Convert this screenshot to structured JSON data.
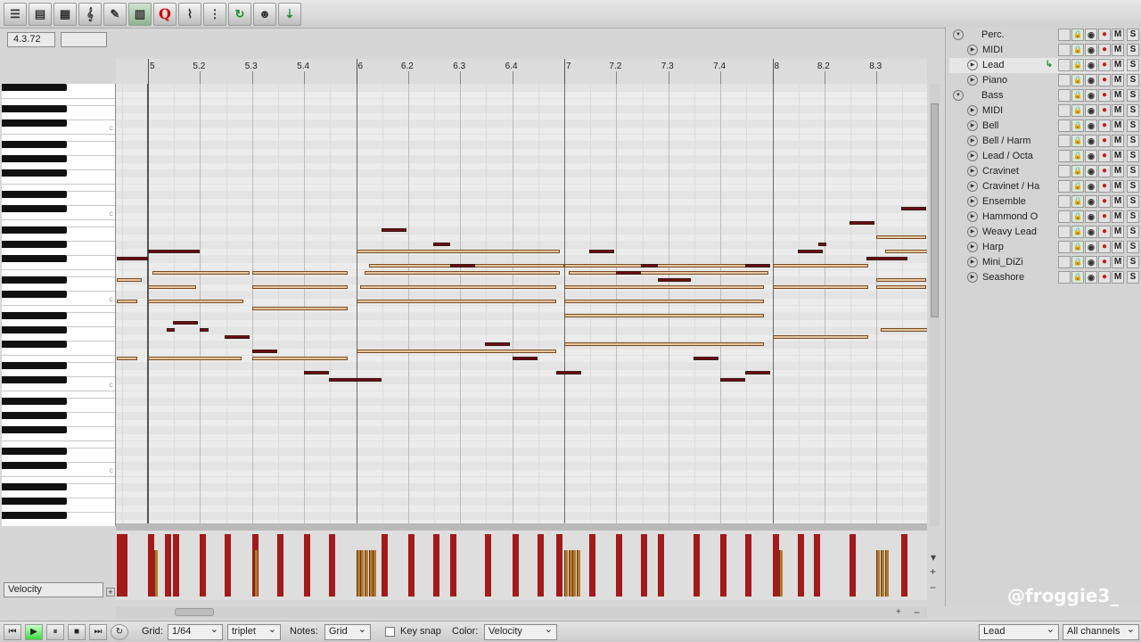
{
  "toolbar": {
    "buttons": [
      {
        "name": "menu-icon",
        "glyph": "☰"
      },
      {
        "name": "list-view-icon",
        "glyph": "▤"
      },
      {
        "name": "grid-view-icon",
        "glyph": "▦"
      },
      {
        "name": "treble-clef-icon",
        "glyph": "𝄞"
      },
      {
        "name": "note-tool-icon",
        "glyph": "✎"
      },
      {
        "name": "piano-roll-icon",
        "glyph": "▥"
      },
      {
        "name": "quantize-icon",
        "glyph": "Q"
      },
      {
        "name": "cc-edit-icon",
        "glyph": "⌇"
      },
      {
        "name": "snap-grid-icon",
        "glyph": "⋮"
      },
      {
        "name": "loop-icon",
        "glyph": "↻"
      },
      {
        "name": "humanize-icon",
        "glyph": "☻"
      },
      {
        "name": "record-input-icon",
        "glyph": "⇣"
      }
    ]
  },
  "position": {
    "value": "4.3.72",
    "length": ""
  },
  "ruler": {
    "labels": [
      {
        "text": "5",
        "bar": 5
      },
      {
        "text": "5.2",
        "bar": 5.25
      },
      {
        "text": "5.3",
        "bar": 5.5
      },
      {
        "text": "5.4",
        "bar": 5.75
      },
      {
        "text": "6",
        "bar": 6
      },
      {
        "text": "6.2",
        "bar": 6.25
      },
      {
        "text": "6.3",
        "bar": 6.5
      },
      {
        "text": "6.4",
        "bar": 6.75
      },
      {
        "text": "7",
        "bar": 7
      },
      {
        "text": "7.2",
        "bar": 7.25
      },
      {
        "text": "7.3",
        "bar": 7.5
      },
      {
        "text": "7.4",
        "bar": 7.75
      },
      {
        "text": "8",
        "bar": 8
      },
      {
        "text": "8.2",
        "bar": 8.25
      },
      {
        "text": "8.3",
        "bar": 8.5
      }
    ]
  },
  "notes": [
    {
      "bar": 4.85,
      "len": 0.15,
      "pitch": 66,
      "sel": true
    },
    {
      "bar": 4.85,
      "len": 0.12,
      "pitch": 63,
      "sel": false
    },
    {
      "bar": 4.85,
      "len": 0.1,
      "pitch": 60,
      "sel": false
    },
    {
      "bar": 4.85,
      "len": 0.1,
      "pitch": 52,
      "sel": false
    },
    {
      "bar": 5.0,
      "len": 0.25,
      "pitch": 67,
      "sel": true
    },
    {
      "bar": 5.02,
      "len": 0.47,
      "pitch": 64,
      "sel": false
    },
    {
      "bar": 5.0,
      "len": 0.23,
      "pitch": 62,
      "sel": false
    },
    {
      "bar": 5.0,
      "len": 0.46,
      "pitch": 60,
      "sel": false
    },
    {
      "bar": 5.0,
      "len": 0.45,
      "pitch": 52,
      "sel": false
    },
    {
      "bar": 5.12,
      "len": 0.12,
      "pitch": 57,
      "sel": true
    },
    {
      "bar": 5.09,
      "len": 0.04,
      "pitch": 56,
      "sel": true
    },
    {
      "bar": 5.25,
      "len": 0.04,
      "pitch": 56,
      "sel": true
    },
    {
      "bar": 5.37,
      "len": 0.12,
      "pitch": 55,
      "sel": true
    },
    {
      "bar": 5.5,
      "len": 0.46,
      "pitch": 64,
      "sel": false
    },
    {
      "bar": 5.5,
      "len": 0.46,
      "pitch": 62,
      "sel": false
    },
    {
      "bar": 5.5,
      "len": 0.46,
      "pitch": 59,
      "sel": false
    },
    {
      "bar": 5.5,
      "len": 0.46,
      "pitch": 52,
      "sel": false
    },
    {
      "bar": 5.5,
      "len": 0.12,
      "pitch": 53,
      "sel": true
    },
    {
      "bar": 5.75,
      "len": 0.12,
      "pitch": 50,
      "sel": true
    },
    {
      "bar": 5.87,
      "len": 0.25,
      "pitch": 49,
      "sel": true
    },
    {
      "bar": 6.0,
      "len": 0.98,
      "pitch": 67,
      "sel": false
    },
    {
      "bar": 6.06,
      "len": 0.94,
      "pitch": 65,
      "sel": false
    },
    {
      "bar": 6.04,
      "len": 0.94,
      "pitch": 64,
      "sel": false
    },
    {
      "bar": 6.02,
      "len": 0.94,
      "pitch": 62,
      "sel": false
    },
    {
      "bar": 6.0,
      "len": 0.96,
      "pitch": 60,
      "sel": false
    },
    {
      "bar": 6.0,
      "len": 0.96,
      "pitch": 53,
      "sel": false
    },
    {
      "bar": 6.12,
      "len": 0.12,
      "pitch": 70,
      "sel": true
    },
    {
      "bar": 6.37,
      "len": 0.08,
      "pitch": 68,
      "sel": true
    },
    {
      "bar": 6.45,
      "len": 0.12,
      "pitch": 65,
      "sel": true
    },
    {
      "bar": 6.62,
      "len": 0.12,
      "pitch": 54,
      "sel": true
    },
    {
      "bar": 6.75,
      "len": 0.12,
      "pitch": 52,
      "sel": true
    },
    {
      "bar": 6.96,
      "len": 0.12,
      "pitch": 50,
      "sel": true
    },
    {
      "bar": 7.0,
      "len": 0.96,
      "pitch": 65,
      "sel": false
    },
    {
      "bar": 7.02,
      "len": 0.96,
      "pitch": 64,
      "sel": false
    },
    {
      "bar": 7.0,
      "len": 0.96,
      "pitch": 62,
      "sel": false
    },
    {
      "bar": 7.0,
      "len": 0.96,
      "pitch": 60,
      "sel": false
    },
    {
      "bar": 7.0,
      "len": 0.96,
      "pitch": 58,
      "sel": false
    },
    {
      "bar": 7.0,
      "len": 0.96,
      "pitch": 54,
      "sel": false
    },
    {
      "bar": 7.12,
      "len": 0.12,
      "pitch": 67,
      "sel": true
    },
    {
      "bar": 7.25,
      "len": 0.12,
      "pitch": 64,
      "sel": true
    },
    {
      "bar": 7.37,
      "len": 0.08,
      "pitch": 65,
      "sel": true
    },
    {
      "bar": 7.45,
      "len": 0.16,
      "pitch": 63,
      "sel": true
    },
    {
      "bar": 7.62,
      "len": 0.12,
      "pitch": 52,
      "sel": true
    },
    {
      "bar": 7.75,
      "len": 0.12,
      "pitch": 49,
      "sel": true
    },
    {
      "bar": 7.87,
      "len": 0.12,
      "pitch": 50,
      "sel": true
    },
    {
      "bar": 7.87,
      "len": 0.12,
      "pitch": 65,
      "sel": true
    },
    {
      "bar": 8.0,
      "len": 0.46,
      "pitch": 65,
      "sel": false
    },
    {
      "bar": 8.0,
      "len": 0.46,
      "pitch": 62,
      "sel": false
    },
    {
      "bar": 8.0,
      "len": 0.46,
      "pitch": 55,
      "sel": false
    },
    {
      "bar": 8.12,
      "len": 0.12,
      "pitch": 67,
      "sel": true
    },
    {
      "bar": 8.22,
      "len": 0.04,
      "pitch": 68,
      "sel": true
    },
    {
      "bar": 8.37,
      "len": 0.12,
      "pitch": 71,
      "sel": true
    },
    {
      "bar": 8.5,
      "len": 0.24,
      "pitch": 69,
      "sel": false
    },
    {
      "bar": 8.54,
      "len": 0.24,
      "pitch": 67,
      "sel": false
    },
    {
      "bar": 8.5,
      "len": 0.24,
      "pitch": 63,
      "sel": false
    },
    {
      "bar": 8.5,
      "len": 0.24,
      "pitch": 62,
      "sel": false
    },
    {
      "bar": 8.52,
      "len": 0.24,
      "pitch": 56,
      "sel": false
    },
    {
      "bar": 8.62,
      "len": 0.12,
      "pitch": 73,
      "sel": true
    },
    {
      "bar": 8.45,
      "len": 0.2,
      "pitch": 66,
      "sel": true
    }
  ],
  "velocity": {
    "lane_label": "Velocity",
    "bars": [
      {
        "bar": 4.85,
        "vel": 1.0,
        "kind": "red"
      },
      {
        "bar": 4.87,
        "vel": 1.0,
        "kind": "red"
      },
      {
        "bar": 5.0,
        "vel": 1.0,
        "kind": "red"
      },
      {
        "bar": 5.03,
        "vel": 0.75,
        "kind": "gold"
      },
      {
        "bar": 5.08,
        "vel": 1.0,
        "kind": "red"
      },
      {
        "bar": 5.12,
        "vel": 1.0,
        "kind": "red"
      },
      {
        "bar": 5.25,
        "vel": 1.0,
        "kind": "red"
      },
      {
        "bar": 5.37,
        "vel": 1.0,
        "kind": "red"
      },
      {
        "bar": 5.5,
        "vel": 1.0,
        "kind": "red"
      },
      {
        "bar": 5.51,
        "vel": 0.75,
        "kind": "gold"
      },
      {
        "bar": 5.62,
        "vel": 1.0,
        "kind": "red"
      },
      {
        "bar": 5.75,
        "vel": 1.0,
        "kind": "red"
      },
      {
        "bar": 5.87,
        "vel": 1.0,
        "kind": "red"
      },
      {
        "bar": 6.0,
        "vel": 0.75,
        "kind": "gold"
      },
      {
        "bar": 6.02,
        "vel": 0.75,
        "kind": "gold"
      },
      {
        "bar": 6.04,
        "vel": 0.75,
        "kind": "gold"
      },
      {
        "bar": 6.06,
        "vel": 0.75,
        "kind": "gold"
      },
      {
        "bar": 6.08,
        "vel": 0.75,
        "kind": "gold"
      },
      {
        "bar": 6.12,
        "vel": 1.0,
        "kind": "red"
      },
      {
        "bar": 6.25,
        "vel": 1.0,
        "kind": "red"
      },
      {
        "bar": 6.37,
        "vel": 1.0,
        "kind": "red"
      },
      {
        "bar": 6.45,
        "vel": 1.0,
        "kind": "red"
      },
      {
        "bar": 6.62,
        "vel": 1.0,
        "kind": "red"
      },
      {
        "bar": 6.75,
        "vel": 1.0,
        "kind": "red"
      },
      {
        "bar": 6.87,
        "vel": 1.0,
        "kind": "red"
      },
      {
        "bar": 6.96,
        "vel": 1.0,
        "kind": "red"
      },
      {
        "bar": 7.0,
        "vel": 0.75,
        "kind": "gold"
      },
      {
        "bar": 7.02,
        "vel": 0.75,
        "kind": "gold"
      },
      {
        "bar": 7.04,
        "vel": 0.75,
        "kind": "gold"
      },
      {
        "bar": 7.06,
        "vel": 0.75,
        "kind": "gold"
      },
      {
        "bar": 7.12,
        "vel": 1.0,
        "kind": "red"
      },
      {
        "bar": 7.25,
        "vel": 1.0,
        "kind": "red"
      },
      {
        "bar": 7.37,
        "vel": 1.0,
        "kind": "red"
      },
      {
        "bar": 7.45,
        "vel": 1.0,
        "kind": "red"
      },
      {
        "bar": 7.62,
        "vel": 1.0,
        "kind": "red"
      },
      {
        "bar": 7.75,
        "vel": 1.0,
        "kind": "red"
      },
      {
        "bar": 7.87,
        "vel": 1.0,
        "kind": "red"
      },
      {
        "bar": 8.0,
        "vel": 1.0,
        "kind": "red"
      },
      {
        "bar": 8.03,
        "vel": 0.75,
        "kind": "gold"
      },
      {
        "bar": 8.12,
        "vel": 1.0,
        "kind": "red"
      },
      {
        "bar": 8.2,
        "vel": 1.0,
        "kind": "red"
      },
      {
        "bar": 8.37,
        "vel": 1.0,
        "kind": "red"
      },
      {
        "bar": 8.5,
        "vel": 0.75,
        "kind": "gold"
      },
      {
        "bar": 8.52,
        "vel": 0.75,
        "kind": "gold"
      },
      {
        "bar": 8.54,
        "vel": 0.75,
        "kind": "gold"
      },
      {
        "bar": 8.62,
        "vel": 1.0,
        "kind": "red"
      }
    ]
  },
  "tracks": [
    {
      "name": "Perc.",
      "folder": true,
      "child": false,
      "sel": false
    },
    {
      "name": "MIDI",
      "folder": false,
      "child": true,
      "sel": false
    },
    {
      "name": "Lead",
      "folder": false,
      "child": true,
      "sel": true
    },
    {
      "name": "Piano",
      "folder": false,
      "child": true,
      "sel": false
    },
    {
      "name": "Bass",
      "folder": true,
      "child": false,
      "sel": false
    },
    {
      "name": "MIDI",
      "folder": false,
      "child": true,
      "sel": false
    },
    {
      "name": "Bell",
      "folder": false,
      "child": true,
      "sel": false
    },
    {
      "name": "Bell / Harm",
      "folder": false,
      "child": true,
      "sel": false
    },
    {
      "name": "Lead / Octa",
      "folder": false,
      "child": true,
      "sel": false
    },
    {
      "name": "Cravinet",
      "folder": false,
      "child": true,
      "sel": false
    },
    {
      "name": "Cravinet / Ha",
      "folder": false,
      "child": true,
      "sel": false
    },
    {
      "name": "Ensemble",
      "folder": false,
      "child": true,
      "sel": false
    },
    {
      "name": "Hammond O",
      "folder": false,
      "child": true,
      "sel": false
    },
    {
      "name": "Weavy Lead",
      "folder": false,
      "child": true,
      "sel": false
    },
    {
      "name": "Harp",
      "folder": false,
      "child": true,
      "sel": false
    },
    {
      "name": "Mini_DiZi",
      "folder": false,
      "child": true,
      "sel": false
    },
    {
      "name": "Seashore",
      "folder": false,
      "child": true,
      "sel": false
    }
  ],
  "track_controls": {
    "mute": "M",
    "solo": "S"
  },
  "bottom": {
    "grid_label": "Grid:",
    "grid_value": "1/64",
    "grid_type": "triplet",
    "notes_label": "Notes:",
    "notes_value": "Grid",
    "key_snap_label": "Key snap",
    "color_label": "Color:",
    "color_value": "Velocity",
    "active_track": "Lead",
    "channel": "All channels"
  },
  "watermark": "@froggie3_",
  "colors": {
    "note_sel": "#6b0d16",
    "note_unsel": "#e5c8a0",
    "vel_red": "#a31a1a",
    "vel_gold": "#b8772a",
    "play": "#3fd93f"
  }
}
